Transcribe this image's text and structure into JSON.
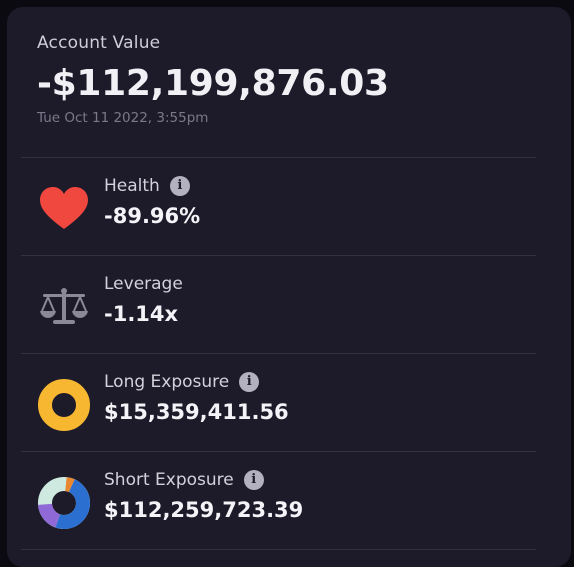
{
  "account": {
    "label": "Account Value",
    "value": "-$112,199,876.03",
    "timestamp": "Tue Oct 11 2022, 3:55pm"
  },
  "metrics": [
    {
      "label": "Health",
      "value": "-89.96%",
      "icon": "heart-icon",
      "has_info": true
    },
    {
      "label": "Leverage",
      "value": "-1.14x",
      "icon": "scale-icon",
      "has_info": false
    },
    {
      "label": "Long Exposure",
      "value": "$15,359,411.56",
      "icon": "donut-chart-icon",
      "has_info": true
    },
    {
      "label": "Short Exposure",
      "value": "$112,259,723.39",
      "icon": "donut-chart-icon",
      "has_info": true
    }
  ],
  "info_glyph": "i",
  "colors": {
    "background": "#1d1b29",
    "heart": "#f0473e",
    "long_donut": "#f7b731",
    "short_donut_segments": [
      "#2b6fd0",
      "#8f69d6",
      "#cde9e0",
      "#e7872f"
    ]
  }
}
